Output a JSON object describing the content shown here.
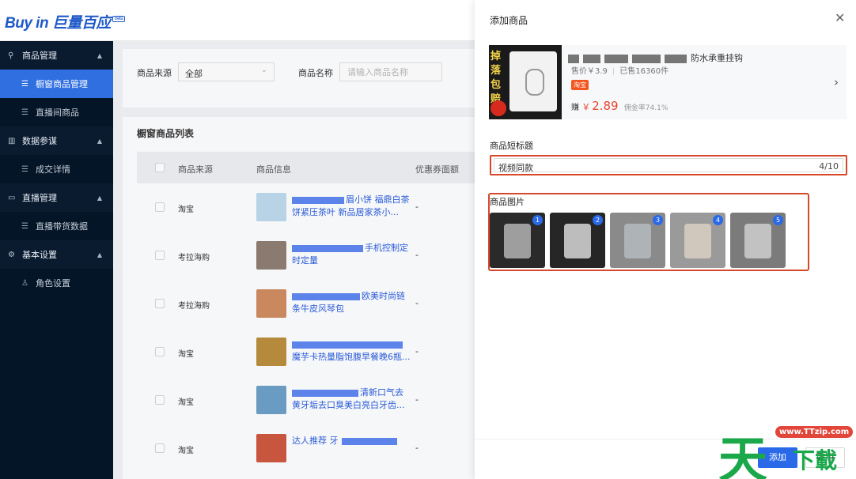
{
  "header": {
    "logo_text": "Buy in 巨量百应",
    "logo_badge": "Beta"
  },
  "sidebar": {
    "groups": [
      {
        "label": "商品管理",
        "icon": "product-icon",
        "items": [
          {
            "label": "橱窗商品管理",
            "active": true
          },
          {
            "label": "直播间商品",
            "active": false
          }
        ]
      },
      {
        "label": "数据参谋",
        "icon": "chart-icon",
        "items": [
          {
            "label": "成交详情",
            "active": false
          }
        ]
      },
      {
        "label": "直播管理",
        "icon": "live-icon",
        "items": [
          {
            "label": "直播带货数据",
            "active": false
          }
        ]
      },
      {
        "label": "基本设置",
        "icon": "settings-icon",
        "items": [
          {
            "label": "角色设置",
            "active": false
          }
        ]
      }
    ]
  },
  "filters": {
    "source_label": "商品来源",
    "source_value": "全部",
    "name_label": "商品名称",
    "name_placeholder": "请输入商品名称"
  },
  "list": {
    "title": "橱窗商品列表",
    "columns": [
      "商品来源",
      "商品信息",
      "优惠券面额"
    ],
    "rows": [
      {
        "source": "淘宝",
        "info_visible": "眉小饼 福鼎白茶饼紧压茶叶 新品居家茶小...",
        "coupon": "-"
      },
      {
        "source": "考拉海购",
        "info_visible": "手机控制定时定量",
        "coupon": "-"
      },
      {
        "source": "考拉海购",
        "info_visible": "欧美时尚链条牛皮风琴包",
        "coupon": "-"
      },
      {
        "source": "淘宝",
        "info_visible": "魔芋卡热量脂饱腹早餐晚6瓶...",
        "coupon": "-"
      },
      {
        "source": "淘宝",
        "info_visible": "清新口气去黄牙垢去口臭美白亮白牙齿...",
        "coupon": "-"
      },
      {
        "source": "淘宝",
        "info_visible": "达人推荐 牙",
        "coupon": "-"
      }
    ]
  },
  "drawer": {
    "title": "添加商品",
    "product": {
      "title_visible": "防水承重挂钩",
      "price_text": "售价￥3.9",
      "sold_text": "已售16360件",
      "platform_tag": "淘宝",
      "earn_label": "赚",
      "earn_currency": "￥",
      "earn_amount": "2.89",
      "commission_text": "佣金率74.1%",
      "image_text": "掉落包赔"
    },
    "short_title_label": "商品短标题",
    "short_title_value": "视频同款",
    "short_title_count": "4/10",
    "images_label": "商品图片",
    "images": [
      {
        "num": "1",
        "color": "#5a5a5a"
      },
      {
        "num": "2",
        "color": "#2b2b2b"
      },
      {
        "num": "3",
        "color": "#8a8a8a"
      },
      {
        "num": "4",
        "color": "#9a9a9a"
      },
      {
        "num": "5",
        "color": "#7a7a7a"
      }
    ],
    "add_button": "添加",
    "cancel_button": "取消"
  },
  "watermark": {
    "site": "www.TTzip.com",
    "text_big": "天",
    "text_small": "下載"
  },
  "colors": {
    "accent": "#2a69e8",
    "sidebar_bg": "#041527",
    "highlight_border": "#d6472c",
    "price": "#e8442d"
  }
}
